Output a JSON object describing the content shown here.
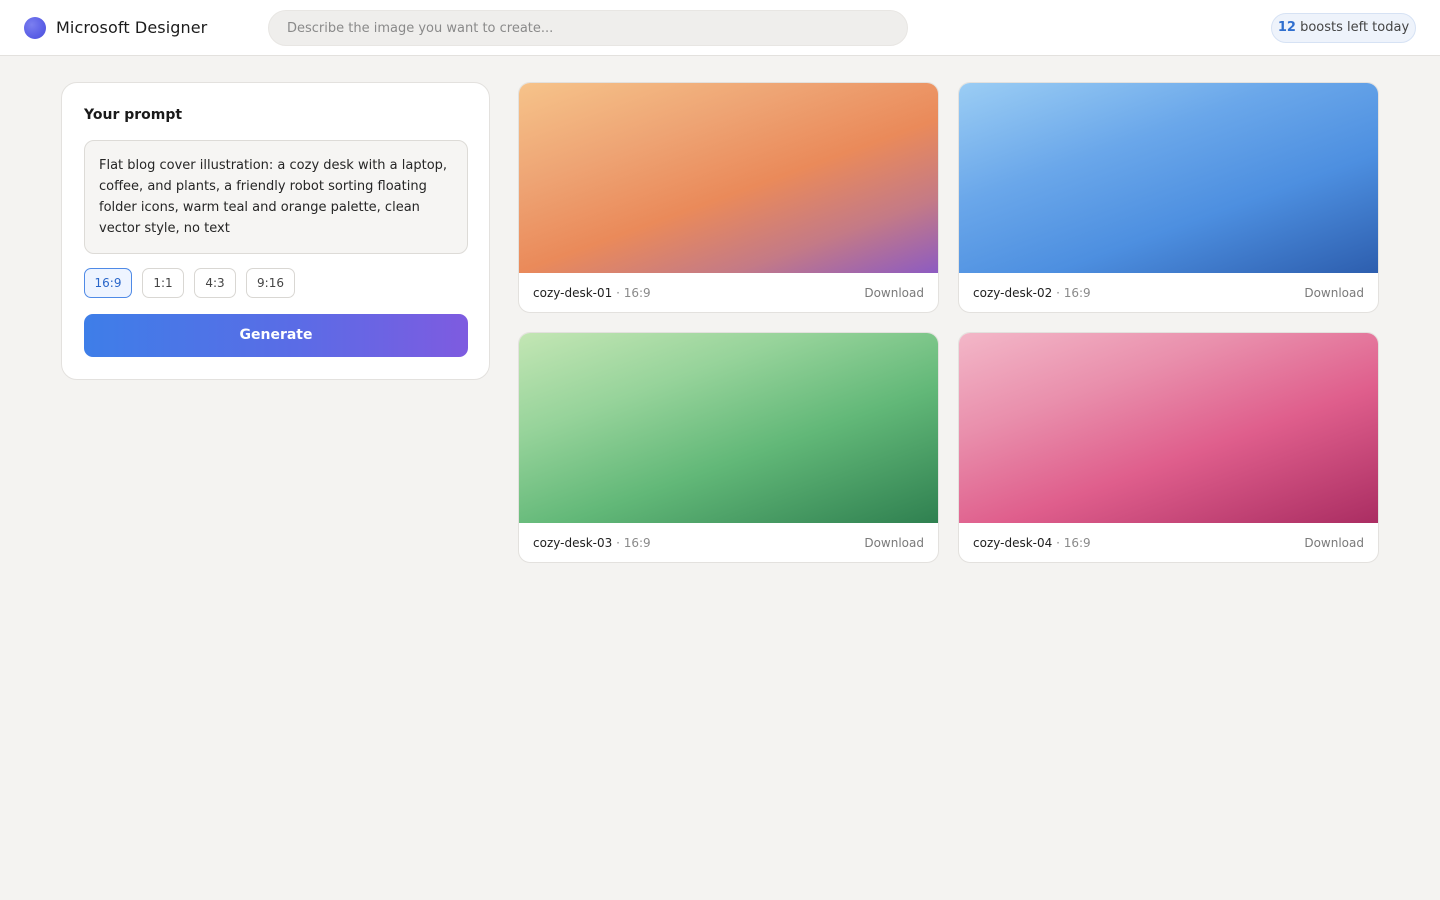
{
  "app": {
    "name": "Microsoft Designer"
  },
  "search": {
    "placeholder": "Describe the image you want to create..."
  },
  "boosts": {
    "count": "12",
    "label": "boosts left today"
  },
  "prompt_panel": {
    "title": "Your prompt",
    "prompt_text": "Flat blog cover illustration: a cozy desk with a laptop, coffee, and plants, a friendly robot sorting floating folder icons, warm teal and orange palette, clean vector style, no text",
    "aspect_ratios": [
      {
        "label": "16:9",
        "selected": true
      },
      {
        "label": "1:1",
        "selected": false
      },
      {
        "label": "4:3",
        "selected": false
      },
      {
        "label": "9:16",
        "selected": false
      }
    ],
    "generate_label": "Generate"
  },
  "results": [
    {
      "name": "cozy-desk-01",
      "ratio": "· 16:9",
      "download_label": "Download",
      "colors": [
        "#f6c38a",
        "#ea8a5a",
        "#8c5bc2"
      ]
    },
    {
      "name": "cozy-desk-02",
      "ratio": "· 16:9",
      "download_label": "Download",
      "colors": [
        "#9bcdf4",
        "#4d8fe0",
        "#2d5eae"
      ]
    },
    {
      "name": "cozy-desk-03",
      "ratio": "· 16:9",
      "download_label": "Download",
      "colors": [
        "#c3e6b4",
        "#62b878",
        "#2f8050"
      ]
    },
    {
      "name": "cozy-desk-04",
      "ratio": "· 16:9",
      "download_label": "Download",
      "colors": [
        "#f3b7c8",
        "#df5e8c",
        "#aa2d62"
      ]
    }
  ],
  "colors": {
    "accent": "#2f6fcf",
    "generate_gradient_start": "#3e7ee8",
    "generate_gradient_end": "#7e5be0"
  }
}
